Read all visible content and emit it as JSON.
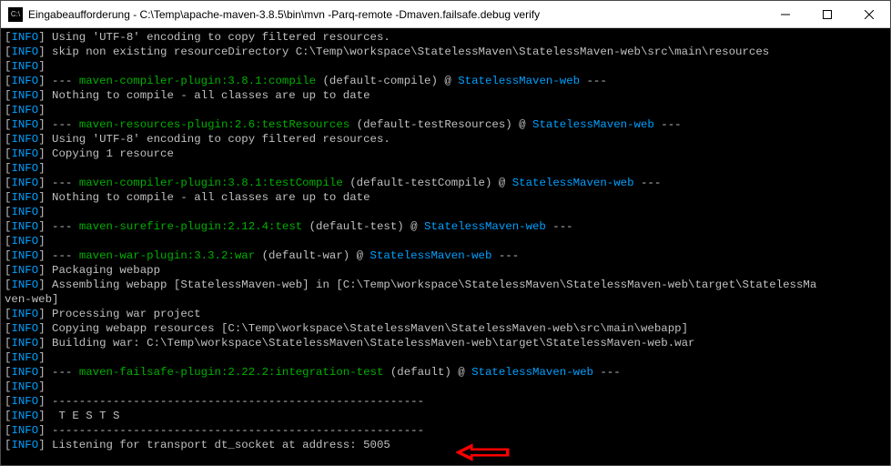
{
  "window": {
    "icon_label": "C:\\",
    "title": "Eingabeaufforderung - C:\\Temp\\apache-maven-3.8.5\\bin\\mvn  -Parq-remote -Dmaven.failsafe.debug verify"
  },
  "tag": {
    "info": "INFO",
    "open": "[",
    "close": "]"
  },
  "plugins": {
    "compile": "maven-compiler-plugin:3.8.1:compile",
    "testRes": "maven-resources-plugin:2.6:testResources",
    "testCompile": "maven-compiler-plugin:3.8.1:testCompile",
    "surefire": "maven-surefire-plugin:2.12.4:test",
    "war": "maven-war-plugin:3.3.2:war",
    "failsafe": "maven-failsafe-plugin:2.22.2:integration-test"
  },
  "project": "StatelessMaven-web",
  "lines": {
    "utf8": " Using 'UTF-8' encoding to copy filtered resources.",
    "skipRes": " skip non existing resourceDirectory C:\\Temp\\workspace\\StatelessMaven\\StatelessMaven-web\\src\\main\\resources",
    "blank": "",
    "sep": " --- ",
    "compile_goal": " (default-compile) @ ",
    "testres_goal": " (default-testResources) @ ",
    "testcompile_goal": " (default-testCompile) @ ",
    "surefire_goal": " (default-test) @ ",
    "war_goal": " (default-war) @ ",
    "failsafe_goal": " (default) @ ",
    "dash_end": " ---",
    "noth": " Nothing to compile - all classes are up to date",
    "copy1": " Copying 1 resource",
    "pack": " Packaging webapp",
    "assemble": " Assembling webapp [StatelessMaven-web] in [C:\\Temp\\workspace\\StatelessMaven\\StatelessMaven-web\\target\\StatelessMa",
    "venweb": "ven-web]",
    "procwar": " Processing war project",
    "copyres": " Copying webapp resources [C:\\Temp\\workspace\\StatelessMaven\\StatelessMaven-web\\src\\main\\webapp]",
    "buildwar": " Building war: C:\\Temp\\workspace\\StatelessMaven\\StatelessMaven-web\\target\\StatelessMaven-web.war",
    "dashes": " -------------------------------------------------------",
    "tests": "  T E S T S",
    "listen": " Listening for transport dt_socket at address: 5005"
  }
}
